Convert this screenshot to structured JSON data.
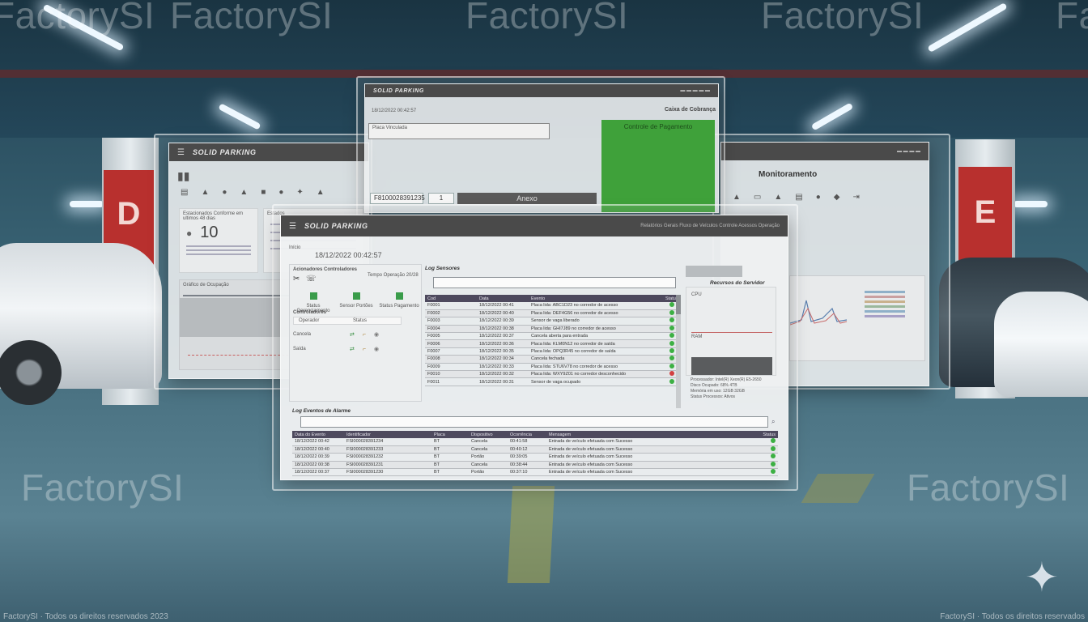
{
  "watermark": {
    "text": "FactorySI"
  },
  "footer": {
    "left": "FactorySI · Todos os direitos reservados 2023",
    "right": "FactorySI · Todos os direitos reservados"
  },
  "pillar_signs": [
    "D",
    "E"
  ],
  "left_window": {
    "title": "SOLID PARKING",
    "card1": {
      "label": "Estacionados Conforme em ultimos 48 dias",
      "value": "10"
    },
    "card2": {
      "label": "Estados"
    },
    "chart_label": "Gráfico de Ocupação"
  },
  "top_window": {
    "title": "SOLID PARKING",
    "timestamp": "18/12/2022 00:42:57",
    "section": "Caixa de Cobrança",
    "filter_label": "Placa Vinculada",
    "green_panel_title": "Controle de Pagamento",
    "input_ticket": "F8100028391235",
    "input_qty": "1",
    "button": "Anexo"
  },
  "right_window": {
    "title": "Monitoramento"
  },
  "main_window": {
    "title": "SOLID PARKING",
    "menu_right": "Relatórios Gerais Fluxo de Veículos Controle Acessos Operação",
    "timestamp_label": "Início",
    "timestamp": "18/12/2022 00:42:57",
    "controls_title": "Acionadores Controladores",
    "controls_right": "Tempo Operação  20/28",
    "quick_buttons": [
      "Status Gerenciamento",
      "Sensor Portões",
      "Status Pagamento"
    ],
    "controllers_title": "Controladores",
    "controllers_headers": [
      "Operador",
      "Status"
    ],
    "controllers_rows": [
      {
        "name": "Cancela"
      },
      {
        "name": "Saída"
      }
    ],
    "log_title": "Log Sensores",
    "log_headers": [
      "Cod",
      "Data",
      "Evento",
      "Status"
    ],
    "log_rows": [
      {
        "cod": "F0001",
        "date": "18/12/2022 00:41",
        "event": "Placa lida: ABC1D23 no corredor de acesso",
        "status": "ok"
      },
      {
        "cod": "F0002",
        "date": "18/12/2022 00:40",
        "event": "Placa lida: DEF4G56 no corredor de acesso",
        "status": "ok"
      },
      {
        "cod": "F0003",
        "date": "18/12/2022 00:39",
        "event": "Sensor de vaga liberado",
        "status": "ok"
      },
      {
        "cod": "F0004",
        "date": "18/12/2022 00:38",
        "event": "Placa lida: GHI7J89 no corredor de acesso",
        "status": "ok"
      },
      {
        "cod": "F0005",
        "date": "18/12/2022 00:37",
        "event": "Cancela aberta para entrada",
        "status": "ok"
      },
      {
        "cod": "F0006",
        "date": "18/12/2022 00:36",
        "event": "Placa lida: KLM0N12 no corredor de saída",
        "status": "ok"
      },
      {
        "cod": "F0007",
        "date": "18/12/2022 00:35",
        "event": "Placa lida: OPQ3R45 no corredor de saída",
        "status": "ok"
      },
      {
        "cod": "F0008",
        "date": "18/12/2022 00:34",
        "event": "Cancela fechada",
        "status": "ok"
      },
      {
        "cod": "F0009",
        "date": "18/12/2022 00:33",
        "event": "Placa lida: STU6V78 no corredor de acesso",
        "status": "ok"
      },
      {
        "cod": "F0010",
        "date": "18/12/2022 00:32",
        "event": "Placa lida: WXY9Z01 no corredor desconhecido",
        "status": "err"
      },
      {
        "cod": "F0011",
        "date": "18/12/2022 00:31",
        "event": "Sensor de vaga ocupado",
        "status": "ok"
      }
    ],
    "server_title": "Recursos do Servidor",
    "server_cpu": "CPU",
    "server_ram": "RAM",
    "server_notes": [
      "Processador: Intel(R) Xeon(R) E5-2650",
      "Disco Ocupado: 68% 4TB",
      "Memória em uso: 12GB 32GB",
      "Status Processos: Ativos"
    ],
    "alarm_log_title": "Log Eventos de Alarme",
    "alarm_headers": [
      "Data do Evento",
      "Identificador",
      "Placa",
      "Dispositivo",
      "Ocorrência",
      "Mensagem",
      "Status"
    ],
    "alarm_rows": [
      {
        "date": "18/12/2022 00:42",
        "id": "FSI000028391234",
        "plate": "BT",
        "device": "Cancela",
        "occ": "00:41:58",
        "msg": "Entrada de veículo efetuada com Sucesso",
        "status": "ok"
      },
      {
        "date": "18/12/2022 00:40",
        "id": "FSI000028391233",
        "plate": "BT",
        "device": "Cancela",
        "occ": "00:40:12",
        "msg": "Entrada de veículo efetuada com Sucesso",
        "status": "ok"
      },
      {
        "date": "18/12/2022 00:39",
        "id": "FSI000028391232",
        "plate": "BT",
        "device": "Portão",
        "occ": "00:39:05",
        "msg": "Entrada de veículo efetuada com Sucesso",
        "status": "ok"
      },
      {
        "date": "18/12/2022 00:38",
        "id": "FSI000028391231",
        "plate": "BT",
        "device": "Cancela",
        "occ": "00:38:44",
        "msg": "Entrada de veículo efetuada com Sucesso",
        "status": "ok"
      },
      {
        "date": "18/12/2022 00:37",
        "id": "FSI000028391230",
        "plate": "BT",
        "device": "Portão",
        "occ": "00:37:10",
        "msg": "Entrada de veículo efetuada com Sucesso",
        "status": "ok"
      }
    ]
  },
  "colors": {
    "titlebar": "#4a4a4a",
    "table_header": "#4e4a5e",
    "status_ok": "#3cb043",
    "status_err": "#d24040",
    "green_panel": "#3fa13a",
    "pillar_sign": "#b8302e"
  }
}
